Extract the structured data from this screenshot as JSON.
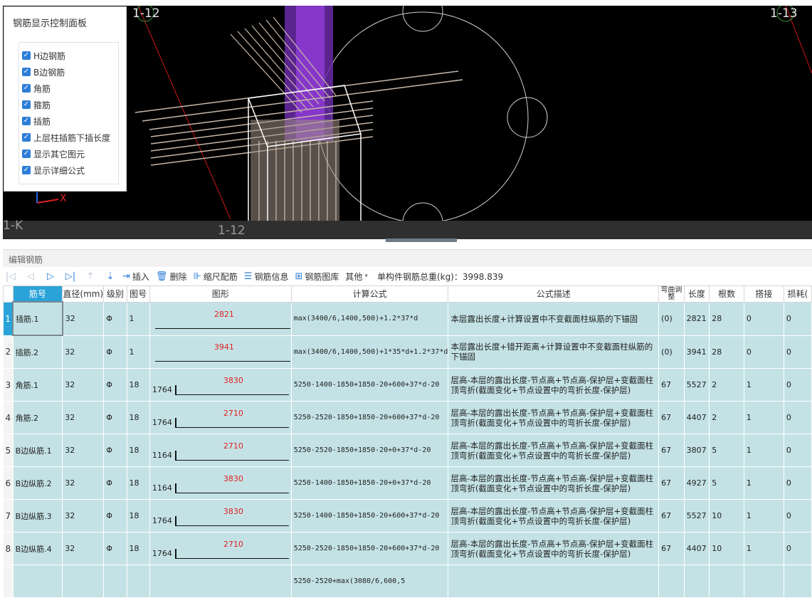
{
  "viewport": {
    "grid_labels": [
      "1-12",
      "1-13",
      "1-K",
      "1-12"
    ],
    "axis_x_label": "X"
  },
  "panel": {
    "title": "钢筋显示控制面板",
    "options": [
      {
        "label": "H边钢筋",
        "checked": true
      },
      {
        "label": "B边钢筋",
        "checked": true
      },
      {
        "label": "角筋",
        "checked": true
      },
      {
        "label": "箍筋",
        "checked": true
      },
      {
        "label": "插筋",
        "checked": true
      },
      {
        "label": "上层柱插筋下插长度",
        "checked": true
      },
      {
        "label": "显示其它图元",
        "checked": true
      },
      {
        "label": "显示详细公式",
        "checked": true
      }
    ]
  },
  "editor": {
    "title": "编辑钢筋",
    "toolbar": {
      "insert": "插入",
      "delete": "删除",
      "scale": "缩尺配筋",
      "info": "钢筋信息",
      "library": "钢筋图库",
      "other": "其他",
      "total": "单构件钢筋总重(kg)：3998.839"
    },
    "columns": [
      "筋号",
      "直径(mm)",
      "级别",
      "图号",
      "图形",
      "计算公式",
      "公式描述",
      "弯曲调整",
      "长度",
      "根数",
      "搭接",
      "损耗("
    ],
    "rows": [
      {
        "n": "1",
        "name": "插筋.1",
        "d": "32",
        "grade": "Φ",
        "fig": "1",
        "lead": "",
        "len_label": "2821",
        "formula": "max(3400/6,1400,500)+1.2*37*d",
        "desc": "本层露出长度+计算设置中不变截面柱纵筋的下锚固",
        "bend": "(0)",
        "length": "2821",
        "count": "28",
        "lap": "0",
        "loss": "0"
      },
      {
        "n": "2",
        "name": "插筋.2",
        "d": "32",
        "grade": "Φ",
        "fig": "1",
        "lead": "",
        "len_label": "3941",
        "formula": "max(3400/6,1400,500)+1*35*d+1.2*37*d",
        "desc": "本层露出长度+错开距离+计算设置中不变截面柱纵筋的下锚固",
        "bend": "(0)",
        "length": "3941",
        "count": "28",
        "lap": "0",
        "loss": "0"
      },
      {
        "n": "3",
        "name": "角筋.1",
        "d": "32",
        "grade": "Φ",
        "fig": "18",
        "lead": "1764",
        "len_label": "3830",
        "formula": "5250-1400-1850+1850-20+600+37*d-20",
        "desc": "层高-本层的露出长度-节点高+节点高-保护层+变截面柱顶弯折(截面变化+节点设置中的弯折长度-保护层)",
        "bend": "67",
        "length": "5527",
        "count": "2",
        "lap": "1",
        "loss": "0"
      },
      {
        "n": "4",
        "name": "角筋.2",
        "d": "32",
        "grade": "Φ",
        "fig": "18",
        "lead": "1764",
        "len_label": "2710",
        "formula": "5250-2520-1850+1850-20+600+37*d-20",
        "desc": "层高-本层的露出长度-节点高+节点高-保护层+变截面柱顶弯折(截面变化+节点设置中的弯折长度-保护层)",
        "bend": "67",
        "length": "4407",
        "count": "2",
        "lap": "1",
        "loss": "0"
      },
      {
        "n": "5",
        "name": "B边纵筋.1",
        "d": "32",
        "grade": "Φ",
        "fig": "18",
        "lead": "1164",
        "len_label": "2710",
        "formula": "5250-2520-1850+1850-20+0+37*d-20",
        "desc": "层高-本层的露出长度-节点高+节点高-保护层+变截面柱顶弯折(截面变化+节点设置中的弯折长度-保护层)",
        "bend": "67",
        "length": "3807",
        "count": "5",
        "lap": "1",
        "loss": "0"
      },
      {
        "n": "6",
        "name": "B边纵筋.2",
        "d": "32",
        "grade": "Φ",
        "fig": "18",
        "lead": "1164",
        "len_label": "3830",
        "formula": "5250-1400-1850+1850-20+0+37*d-20",
        "desc": "层高-本层的露出长度-节点高+节点高-保护层+变截面柱顶弯折(截面变化+节点设置中的弯折长度-保护层)",
        "bend": "67",
        "length": "4927",
        "count": "5",
        "lap": "1",
        "loss": "0"
      },
      {
        "n": "7",
        "name": "B边纵筋.3",
        "d": "32",
        "grade": "Φ",
        "fig": "18",
        "lead": "1764",
        "len_label": "3830",
        "formula": "5250-1400-1850+1850-20+600+37*d-20",
        "desc": "层高-本层的露出长度-节点高+节点高-保护层+变截面柱顶弯折(截面变化+节点设置中的弯折长度-保护层)",
        "bend": "67",
        "length": "5527",
        "count": "10",
        "lap": "1",
        "loss": "0"
      },
      {
        "n": "8",
        "name": "B边纵筋.4",
        "d": "32",
        "grade": "Φ",
        "fig": "18",
        "lead": "1764",
        "len_label": "2710",
        "formula": "5250-2520-1850+1850-20+600+37*d-20",
        "desc": "层高-本层的露出长度-节点高+节点高-保护层+变截面柱顶弯折(截面变化+节点设置中的弯折长度-保护层)",
        "bend": "67",
        "length": "4407",
        "count": "10",
        "lap": "1",
        "loss": "0"
      },
      {
        "n": "",
        "name": "",
        "d": "",
        "grade": "",
        "fig": "",
        "lead": "",
        "len_label": "",
        "formula": "5250-2520+max(3080/6,600,5",
        "desc": "",
        "bend": "",
        "length": "",
        "count": "",
        "lap": "",
        "loss": ""
      }
    ]
  }
}
